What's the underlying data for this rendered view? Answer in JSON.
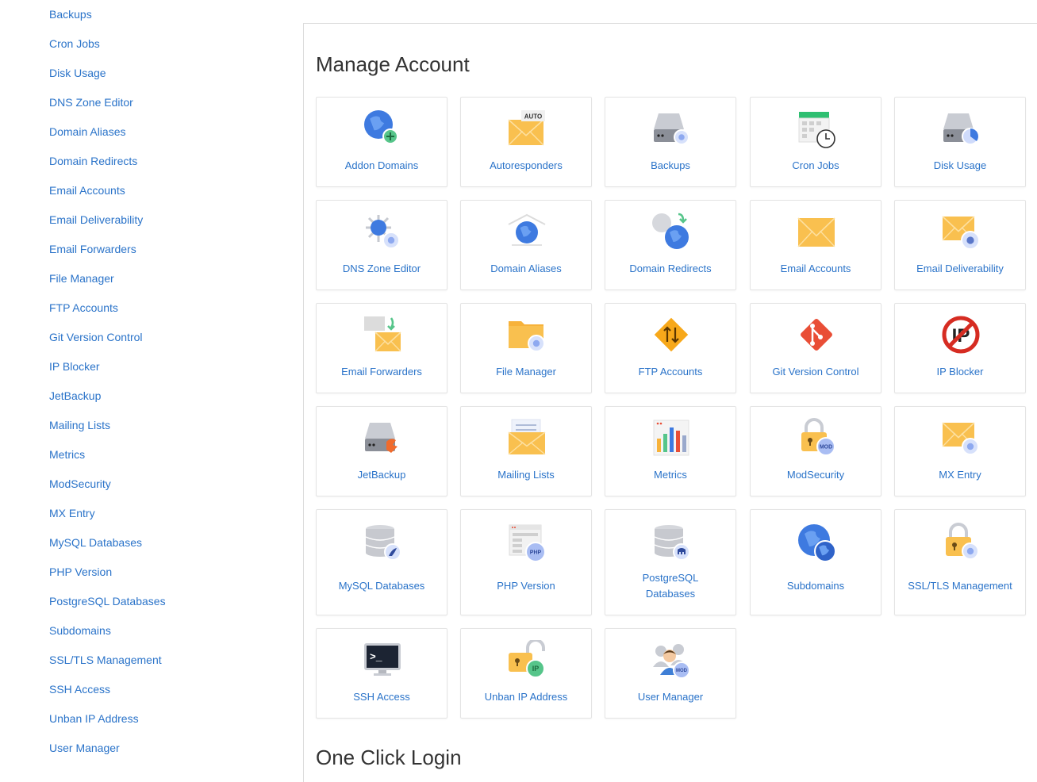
{
  "sidebar": {
    "items": [
      "Backups",
      "Cron Jobs",
      "Disk Usage",
      "DNS Zone Editor",
      "Domain Aliases",
      "Domain Redirects",
      "Email Accounts",
      "Email Deliverability",
      "Email Forwarders",
      "File Manager",
      "FTP Accounts",
      "Git Version Control",
      "IP Blocker",
      "JetBackup",
      "Mailing Lists",
      "Metrics",
      "ModSecurity",
      "MX Entry",
      "MySQL Databases",
      "PHP Version",
      "PostgreSQL Databases",
      "Subdomains",
      "SSL/TLS Management",
      "SSH Access",
      "Unban IP Address",
      "User Manager"
    ]
  },
  "main": {
    "title": "Manage Account",
    "footer_title": "One Click Login",
    "tiles": [
      {
        "label": "Addon Domains",
        "icon": "globe-plus-icon"
      },
      {
        "label": "Autoresponders",
        "icon": "envelope-auto-icon",
        "badge": "AUTO"
      },
      {
        "label": "Backups",
        "icon": "drive-restore-icon"
      },
      {
        "label": "Cron Jobs",
        "icon": "calendar-clock-icon"
      },
      {
        "label": "Disk Usage",
        "icon": "drive-pie-icon"
      },
      {
        "label": "DNS Zone Editor",
        "icon": "network-gear-icon"
      },
      {
        "label": "Domain Aliases",
        "icon": "globe-house-icon"
      },
      {
        "label": "Domain Redirects",
        "icon": "globe-arrow-icon"
      },
      {
        "label": "Email Accounts",
        "icon": "envelope-icon"
      },
      {
        "label": "Email Deliverability",
        "icon": "envelope-key-icon"
      },
      {
        "label": "Email Forwarders",
        "icon": "envelope-forward-icon"
      },
      {
        "label": "File Manager",
        "icon": "folder-gear-icon"
      },
      {
        "label": "FTP Accounts",
        "icon": "ftp-arrows-icon"
      },
      {
        "label": "Git Version Control",
        "icon": "git-icon"
      },
      {
        "label": "IP Blocker",
        "icon": "ip-blocked-icon",
        "badge": "IP"
      },
      {
        "label": "JetBackup",
        "icon": "drive-jet-icon"
      },
      {
        "label": "Mailing Lists",
        "icon": "envelope-list-icon"
      },
      {
        "label": "Metrics",
        "icon": "bar-chart-icon"
      },
      {
        "label": "ModSecurity",
        "icon": "lock-mod-icon",
        "badge": "MOD"
      },
      {
        "label": "MX Entry",
        "icon": "envelope-gear-icon"
      },
      {
        "label": "MySQL Databases",
        "icon": "database-dolphin-icon"
      },
      {
        "label": "PHP Version",
        "icon": "php-page-icon",
        "badge": "PHP"
      },
      {
        "label": "PostgreSQL",
        "label2": "Databases",
        "icon": "database-elephant-icon"
      },
      {
        "label": "Subdomains",
        "icon": "globes-icon"
      },
      {
        "label": "SSL/TLS Management",
        "icon": "lock-gear-icon"
      },
      {
        "label": "SSH Access",
        "icon": "terminal-icon",
        "badge": ">_"
      },
      {
        "label": "Unban IP Address",
        "icon": "unlock-ip-icon",
        "badge": "IP"
      },
      {
        "label": "User Manager",
        "icon": "users-mod-icon",
        "badge": "MOD"
      }
    ]
  },
  "colors": {
    "link": "#2a73c9",
    "globe_blue": "#3e7ae0",
    "envelope_orange": "#f9c04f",
    "gear_blue": "#8ea9f0",
    "git_red": "#e94e36",
    "ip_red": "#d62c22",
    "plus_green": "#56c58a"
  }
}
